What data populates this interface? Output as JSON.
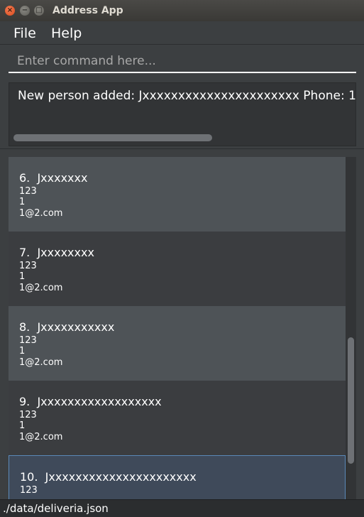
{
  "window": {
    "title": "Address App",
    "close_glyph": "×",
    "minimize_glyph": "−",
    "maximize_glyph": "□"
  },
  "menu": {
    "file": "File",
    "help": "Help"
  },
  "command": {
    "placeholder": "Enter command here...",
    "value": ""
  },
  "result": {
    "text": "New person added: Jxxxxxxxxxxxxxxxxxxxxxx Phone: 1"
  },
  "persons": [
    {
      "index": "6.",
      "name": "Jxxxxxxx",
      "phone": "123",
      "address": "1",
      "email": "1@2.com"
    },
    {
      "index": "7.",
      "name": "Jxxxxxxxx",
      "phone": "123",
      "address": "1",
      "email": "1@2.com"
    },
    {
      "index": "8.",
      "name": "Jxxxxxxxxxxx",
      "phone": "123",
      "address": "1",
      "email": "1@2.com"
    },
    {
      "index": "9.",
      "name": "Jxxxxxxxxxxxxxxxxxx",
      "phone": "123",
      "address": "1",
      "email": "1@2.com"
    },
    {
      "index": "10.",
      "name": "Jxxxxxxxxxxxxxxxxxxxxxx",
      "phone": "123",
      "address": "",
      "email": ""
    }
  ],
  "status": {
    "path": "./data/deliveria.json"
  },
  "colors": {
    "background": "#3c3f41",
    "card_alt": "#4e5357",
    "card_selected": "#3f4a5a",
    "selection_border": "#5a89b8"
  }
}
